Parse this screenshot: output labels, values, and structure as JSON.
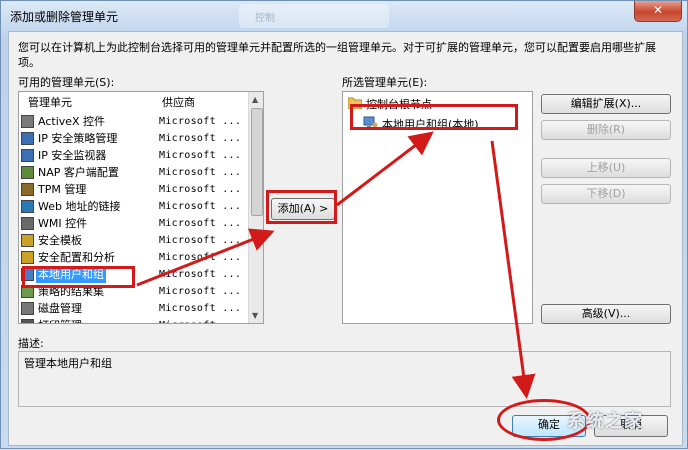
{
  "window": {
    "title": "添加或删除管理单元",
    "background_tab": "控制",
    "close_glyph": "✕"
  },
  "intro_text": "您可以在计算机上为此控制台选择可用的管理单元并配置所选的一组管理单元。对于可扩展的管理单元，您可以配置要启用哪些扩展项。",
  "available": {
    "label": "可用的管理单元(S):",
    "col_name": "管理单元",
    "col_vendor": "供应商",
    "items": [
      {
        "name": "ActiveX 控件",
        "vendor": "Microsoft ...",
        "icon": "activex-icon"
      },
      {
        "name": "IP 安全策略管理",
        "vendor": "Microsoft ...",
        "icon": "ip-security-policy-icon"
      },
      {
        "name": "IP 安全监视器",
        "vendor": "Microsoft ...",
        "icon": "ip-security-monitor-icon"
      },
      {
        "name": "NAP 客户端配置",
        "vendor": "Microsoft ...",
        "icon": "nap-client-icon"
      },
      {
        "name": "TPM 管理",
        "vendor": "Microsoft ...",
        "icon": "tpm-icon"
      },
      {
        "name": "Web 地址的链接",
        "vendor": "Microsoft ...",
        "icon": "web-link-icon"
      },
      {
        "name": "WMI 控件",
        "vendor": "Microsoft ...",
        "icon": "wmi-icon"
      },
      {
        "name": "安全模板",
        "vendor": "Microsoft ...",
        "icon": "security-template-icon"
      },
      {
        "name": "安全配置和分析",
        "vendor": "Microsoft ...",
        "icon": "security-analysis-icon"
      },
      {
        "name": "本地用户和组",
        "vendor": "Microsoft ...",
        "icon": "local-users-icon",
        "selected": true
      },
      {
        "name": "策略的结果集",
        "vendor": "Microsoft ...",
        "icon": "rsop-icon"
      },
      {
        "name": "磁盘管理",
        "vendor": "Microsoft ...",
        "icon": "disk-management-icon"
      },
      {
        "name": "打印管理",
        "vendor": "Microsoft ...",
        "icon": "print-management-icon"
      }
    ]
  },
  "add_button": "添加(A) >",
  "selected": {
    "label": "所选管理单元(E):",
    "root": "控制台根节点",
    "child": "本地用户和组(本地)"
  },
  "side_buttons": {
    "edit_extensions": "编辑扩展(X)...",
    "remove": "删除(R)",
    "move_up": "上移(U)",
    "move_down": "下移(D)",
    "advanced": "高级(V)..."
  },
  "description": {
    "label": "描述:",
    "text": "管理本地用户和组"
  },
  "bottom_buttons": {
    "ok": "确定",
    "cancel": "取消"
  },
  "watermark": "系统之家",
  "colors": {
    "annotation_red": "#d21a1a",
    "selection_blue": "#3399ff"
  }
}
